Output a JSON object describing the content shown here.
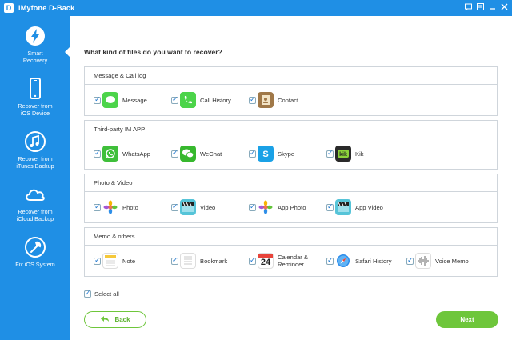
{
  "window": {
    "app_logo": "D",
    "title": "iMyfone D-Back",
    "controls": [
      "message-icon",
      "settings-icon",
      "minimize-icon",
      "close-icon"
    ]
  },
  "sidebar": {
    "items": [
      {
        "label": "Smart\nRecovery",
        "icon": "lightning-icon",
        "active": true
      },
      {
        "label": "Recover from\niOS Device",
        "icon": "iphone-icon",
        "active": false
      },
      {
        "label": "Recover from\niTunes Backup",
        "icon": "music-note-icon",
        "active": false
      },
      {
        "label": "Recover from\niCloud Backup",
        "icon": "cloud-icon",
        "active": false
      },
      {
        "label": "Fix iOS System",
        "icon": "wrench-icon",
        "active": false
      }
    ]
  },
  "main": {
    "question": "What kind of files do you want to recover?",
    "groups": [
      {
        "title": "Message & Call log",
        "items": [
          {
            "label": "Message",
            "icon": "message-icon",
            "checked": true
          },
          {
            "label": "Call History",
            "icon": "phone-icon",
            "checked": true
          },
          {
            "label": "Contact",
            "icon": "contacts-icon",
            "checked": true
          }
        ]
      },
      {
        "title": "Third-party IM APP",
        "items": [
          {
            "label": "WhatsApp",
            "icon": "whatsapp-icon",
            "checked": true
          },
          {
            "label": "WeChat",
            "icon": "wechat-icon",
            "checked": true
          },
          {
            "label": "Skype",
            "icon": "skype-icon",
            "checked": true
          },
          {
            "label": "Kik",
            "icon": "kik-icon",
            "checked": true
          }
        ]
      },
      {
        "title": "Photo & Video",
        "items": [
          {
            "label": "Photo",
            "icon": "photos-icon",
            "checked": true
          },
          {
            "label": "Video",
            "icon": "video-icon",
            "checked": true
          },
          {
            "label": "App Photo",
            "icon": "app-photo-icon",
            "checked": true
          },
          {
            "label": "App Video",
            "icon": "app-video-icon",
            "checked": true
          }
        ]
      },
      {
        "title": "Memo & others",
        "items": [
          {
            "label": "Note",
            "icon": "notes-icon",
            "checked": true
          },
          {
            "label": "Bookmark",
            "icon": "bookmark-icon",
            "checked": true
          },
          {
            "label": "Calendar &\nReminder",
            "icon": "calendar-icon",
            "checked": true,
            "calendar_day": "24"
          },
          {
            "label": "Safari History",
            "icon": "safari-icon",
            "checked": true
          },
          {
            "label": "Voice Memo",
            "icon": "voice-memo-icon",
            "checked": true
          }
        ]
      }
    ],
    "select_all": {
      "label": "Select all",
      "checked": true
    }
  },
  "footer": {
    "back_label": "Back",
    "next_label": "Next"
  },
  "colors": {
    "accent_blue": "#1f8fe5",
    "button_green": "#6ec63b",
    "border": "#cfd5db"
  }
}
